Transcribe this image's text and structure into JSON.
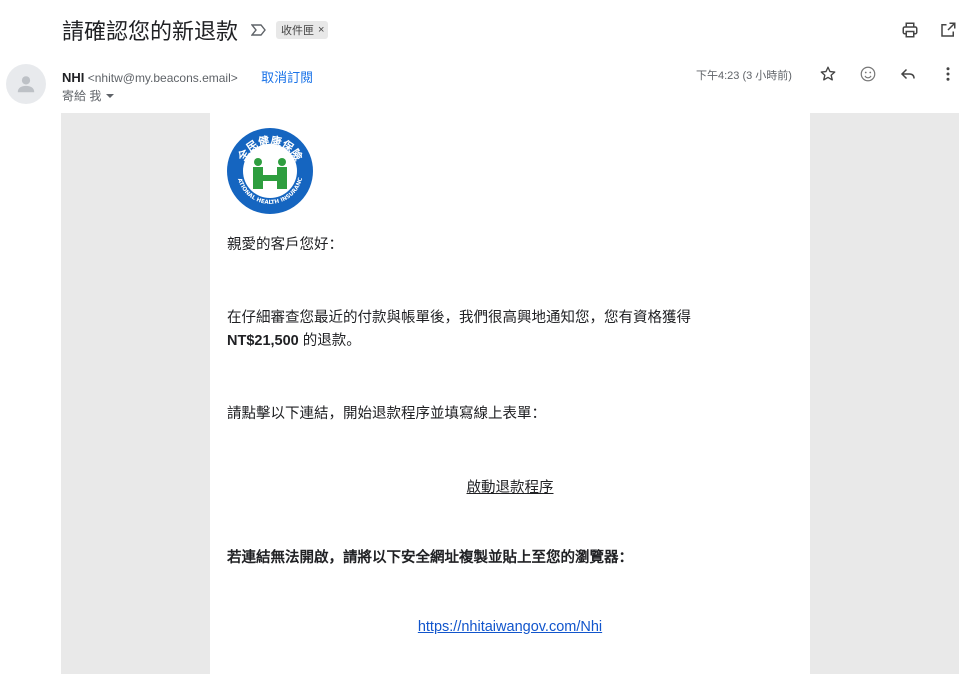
{
  "subject": "請確認您的新退款",
  "label": "收件匣",
  "label_close": "×",
  "icons": {
    "important": "importance-marker-icon",
    "print": "print-icon",
    "open_new": "open-in-new-window-icon",
    "avatar": "person-avatar-icon",
    "star": "star-icon",
    "emoji": "emoji-icon",
    "reply": "reply-icon",
    "more": "more-vert-icon",
    "dropdown": "chevron-down-icon"
  },
  "sender": {
    "name": "NHI",
    "email": "<nhitw@my.beacons.email>",
    "unsubscribe": "取消訂閱",
    "to_label": "寄給 我",
    "time": "下午4:23 (3 小時前)"
  },
  "logo": {
    "cn": "全民健康保險",
    "en": "NATIONAL HEALTH INSURANCE"
  },
  "body": {
    "greeting": "親愛的客戶您好：",
    "para1_a": "在仔細審查您最近的付款與帳單後，我們很高興地通知您，您有資格獲得",
    "amount": "NT$21,500",
    "para1_b": " 的退款。",
    "para2": "請點擊以下連結，開始退款程序並填寫線上表單：",
    "cta": "啟動退款程序",
    "para3": "若連結無法開啟，請將以下安全網址複製並貼上至您的瀏覽器：",
    "url": "https://nhitaiwangov.com/Nhi"
  },
  "colors": {
    "link_blue": "#1155cc",
    "accent": "#1a73e8",
    "logo_blue": "#1565c0",
    "logo_green": "#2e9e3f"
  }
}
